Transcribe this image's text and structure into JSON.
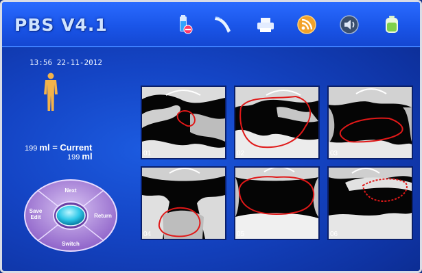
{
  "header": {
    "title": "PBS V4.1",
    "icons": [
      "probe-battery-icon",
      "probe-icon",
      "printer-icon",
      "rss-icon",
      "speaker-icon",
      "battery-icon"
    ]
  },
  "status": {
    "datetime": "13:56 22-11-2012"
  },
  "volume": {
    "line1_value": "199",
    "line1_unit": "ml = Current",
    "line2_value": "199",
    "line2_unit": "ml"
  },
  "dpad": {
    "up": "Next",
    "left_line1": "Save",
    "left_line2": "Edit",
    "right": "Return",
    "down": "Switch"
  },
  "images": [
    {
      "label": "01"
    },
    {
      "label": "02"
    },
    {
      "label": "03"
    },
    {
      "label": "04"
    },
    {
      "label": "05"
    },
    {
      "label": "06"
    }
  ],
  "colors": {
    "outline": "#e01818",
    "screen_bg": "#1444c4",
    "dpad": "#b58de0"
  }
}
